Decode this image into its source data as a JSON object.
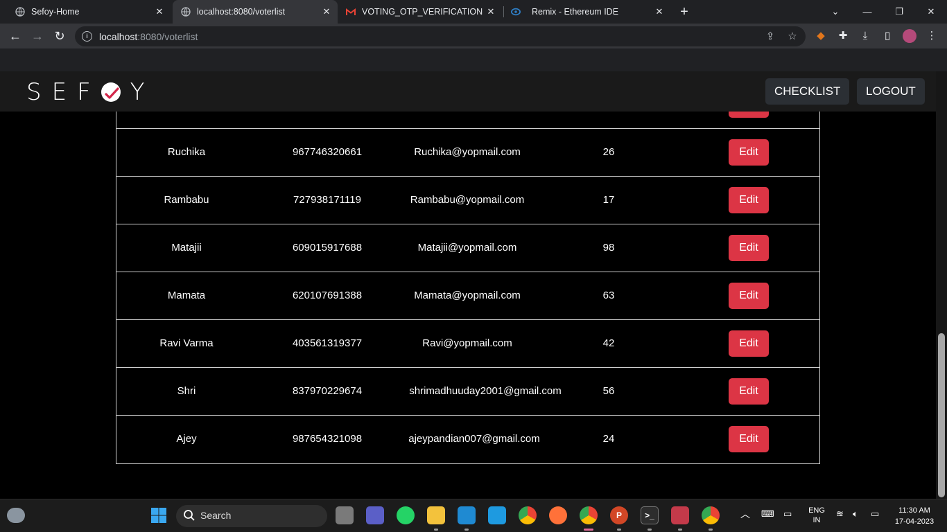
{
  "browser": {
    "tabs": [
      {
        "title": "Sefoy-Home",
        "favicon": "globe-icon",
        "active": false
      },
      {
        "title": "localhost:8080/voterlist",
        "favicon": "globe-icon",
        "active": true
      },
      {
        "title": "VOTING_OTP_VERIFICATION - sh",
        "favicon": "gmail-icon",
        "active": false
      },
      {
        "title": "Remix - Ethereum IDE",
        "favicon": "remix-icon",
        "active": false
      }
    ],
    "address": {
      "host": "localhost",
      "path": ":8080/voterlist"
    }
  },
  "navbar": {
    "logo_left": "SEF",
    "logo_right": "Y",
    "buttons": {
      "checklist": "CHECKLIST",
      "logout": "LOGOUT"
    }
  },
  "voters": [
    {
      "name": "Ruchika",
      "phone": "967746320661",
      "email": "Ruchika@yopmail.com",
      "age": "26",
      "action": "Edit"
    },
    {
      "name": "Rambabu",
      "phone": "727938171119",
      "email": "Rambabu@yopmail.com",
      "age": "17",
      "action": "Edit"
    },
    {
      "name": "Matajii",
      "phone": "609015917688",
      "email": "Matajii@yopmail.com",
      "age": "98",
      "action": "Edit"
    },
    {
      "name": "Mamata",
      "phone": "620107691388",
      "email": "Mamata@yopmail.com",
      "age": "63",
      "action": "Edit"
    },
    {
      "name": "Ravi Varma",
      "phone": "403561319377",
      "email": "Ravi@yopmail.com",
      "age": "42",
      "action": "Edit"
    },
    {
      "name": "Shri",
      "phone": "837970229674",
      "email": "shrimadhuuday2001@gmail.com",
      "age": "56",
      "action": "Edit"
    },
    {
      "name": "Ajey",
      "phone": "987654321098",
      "email": "ajeypandian007@gmail.com",
      "age": "24",
      "action": "Edit"
    }
  ],
  "taskbar": {
    "search_label": "Search",
    "language": {
      "line1": "ENG",
      "line2": "IN"
    },
    "time": "11:30 AM",
    "date": "17-04-2023"
  },
  "colors": {
    "edit_button": "#dc3545",
    "navbar_bg": "#1a1a1a",
    "page_bg": "#000000"
  }
}
